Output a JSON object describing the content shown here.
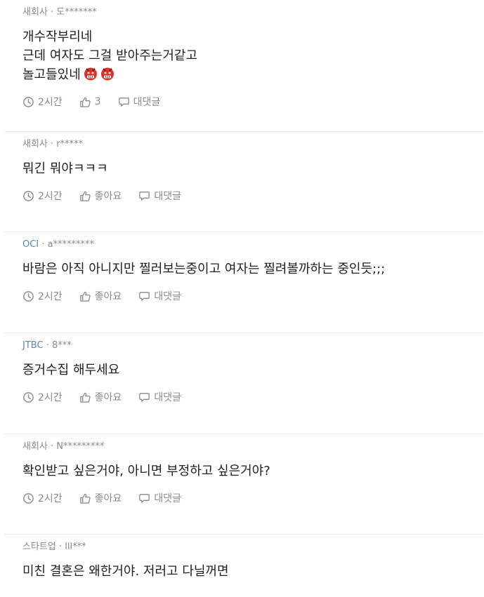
{
  "comments": [
    {
      "company": "새회사",
      "author": "도*******",
      "lines": [
        "개수작부리네",
        "근데 여자도 그걸 받아주는거같고",
        "놀고들있네"
      ],
      "emojis": [
        "angry-face-icon",
        "angry-face-icon"
      ],
      "time": "2시간",
      "likes": "3",
      "reply_label": "대댓글"
    },
    {
      "company": "새회사",
      "author": "r*****",
      "lines": [
        "뭐긴 뭐야ㅋㅋㅋ"
      ],
      "time": "2시간",
      "likes": "좋아요",
      "reply_label": "대댓글"
    },
    {
      "company": "OCI",
      "author": "a*********",
      "lines": [
        "바람은 아직 아니지만 찔러보는중이고 여자는 찔려볼까하는 중인듯;;;"
      ],
      "time": "2시간",
      "likes": "좋아요",
      "reply_label": "대댓글"
    },
    {
      "company": "JTBC",
      "author": "8***",
      "lines": [
        "증거수집 해두세요"
      ],
      "time": "2시간",
      "likes": "좋아요",
      "reply_label": "대댓글"
    },
    {
      "company": "새회사",
      "author": "N*********",
      "lines": [
        "확인받고 싶은거야, 아니면 부정하고 싶은거야?"
      ],
      "time": "2시간",
      "likes": "좋아요",
      "reply_label": "대댓글"
    },
    {
      "company": "스타트업",
      "author": "lll***",
      "lines": [
        "미친 결혼은 왜한거야. 저러고 다닐꺼면"
      ]
    }
  ],
  "colors": {
    "meta_gray": "#8a8a8a",
    "company_link": "#5a86b5",
    "divider": "#ececec",
    "emoji_red": "#d9332b"
  }
}
